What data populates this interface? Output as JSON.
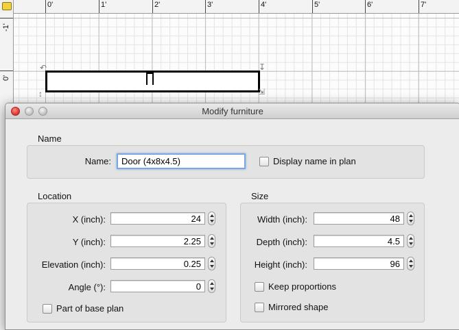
{
  "ruler": {
    "top_labels": [
      "0'",
      "1'",
      "2'",
      "3'",
      "4'",
      "5'",
      "6'",
      "7'"
    ],
    "left_labels": [
      "-1'",
      "0'"
    ]
  },
  "icons": {
    "corner": "folder-icon",
    "rotate": "rotate-handle-icon",
    "elevate": "elevation-handle-icon",
    "height": "height-handle-icon",
    "resize": "resize-handle-icon"
  },
  "dialog": {
    "title": "Modify furniture",
    "name_section": {
      "title": "Name",
      "name_label": "Name:",
      "name_value": "Door (4x8x4.5)",
      "display_name_label": "Display name in plan",
      "display_name_checked": false
    },
    "location": {
      "title": "Location",
      "x_label": "X (inch):",
      "x_value": "24",
      "y_label": "Y (inch):",
      "y_value": "2.25",
      "elevation_label": "Elevation (inch):",
      "elevation_value": "0.25",
      "angle_label": "Angle (°):",
      "angle_value": "0",
      "base_plan_label": "Part of base plan",
      "base_plan_checked": false
    },
    "size": {
      "title": "Size",
      "width_label": "Width (inch):",
      "width_value": "48",
      "depth_label": "Depth (inch):",
      "depth_value": "4.5",
      "height_label": "Height (inch):",
      "height_value": "96",
      "keep_proportions_label": "Keep proportions",
      "keep_proportions_checked": false,
      "mirrored_label": "Mirrored shape",
      "mirrored_checked": false
    }
  },
  "colors": {
    "close_button": "#d8322c",
    "selection": "#b5d3f7",
    "focus_ring": "#7aa7e0"
  }
}
